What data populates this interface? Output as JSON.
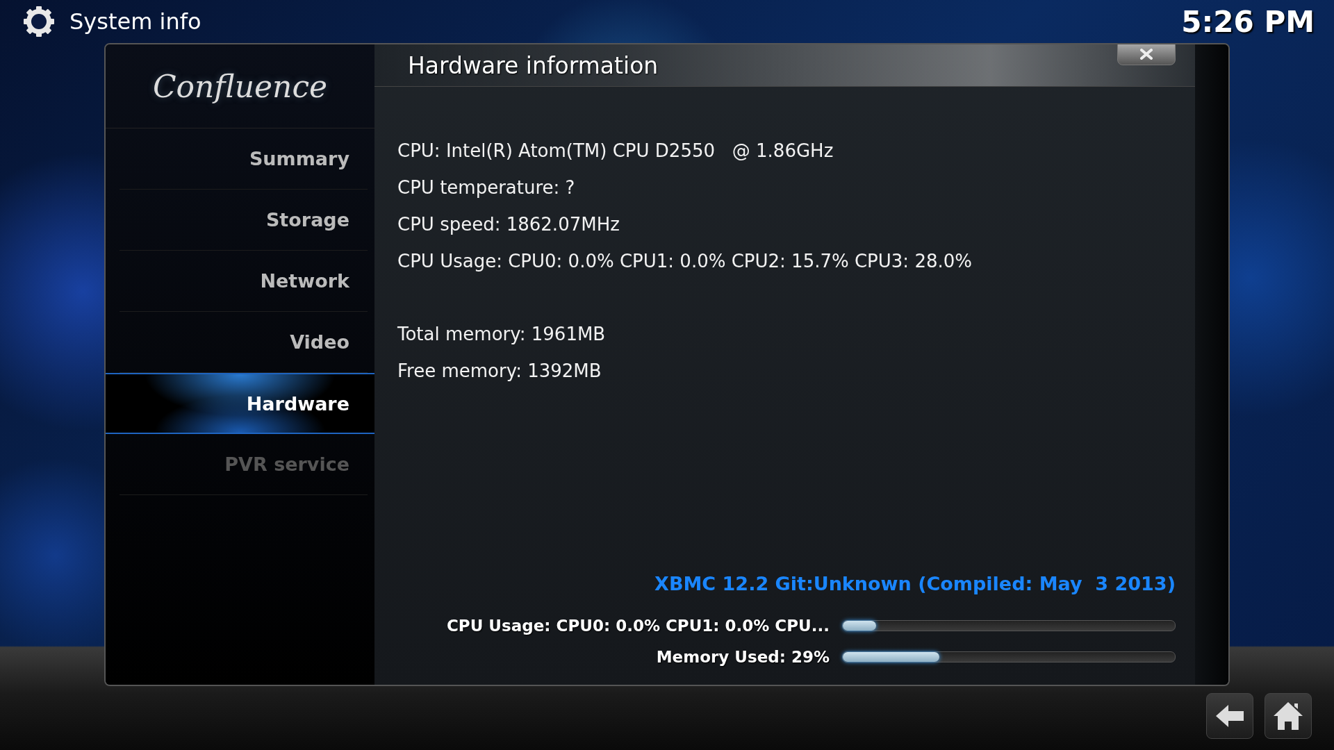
{
  "header": {
    "title": "System info",
    "clock": "5:26 PM"
  },
  "logo": "Confluence",
  "sidebar": {
    "items": [
      {
        "label": "Summary",
        "selected": false,
        "disabled": false
      },
      {
        "label": "Storage",
        "selected": false,
        "disabled": false
      },
      {
        "label": "Network",
        "selected": false,
        "disabled": false
      },
      {
        "label": "Video",
        "selected": false,
        "disabled": false
      },
      {
        "label": "Hardware",
        "selected": true,
        "disabled": false
      },
      {
        "label": "PVR service",
        "selected": false,
        "disabled": true
      }
    ]
  },
  "dialog": {
    "title": "Hardware information",
    "info_groups": [
      [
        "CPU: Intel(R) Atom(TM) CPU D2550   @ 1.86GHz",
        "CPU temperature: ?",
        "CPU speed: 1862.07MHz",
        "CPU Usage: CPU0: 0.0% CPU1: 0.0% CPU2: 15.7% CPU3: 28.0%"
      ],
      [
        "Total memory: 1961MB",
        "Free memory: 1392MB"
      ]
    ],
    "version": "XBMC 12.2 Git:Unknown (Compiled: May  3 2013)",
    "meters": [
      {
        "label": "CPU Usage: CPU0: 0.0% CPU1: 0.0% CPU...",
        "level": 0.1
      },
      {
        "label": "Memory Used: 29%",
        "level": 0.29
      }
    ]
  }
}
